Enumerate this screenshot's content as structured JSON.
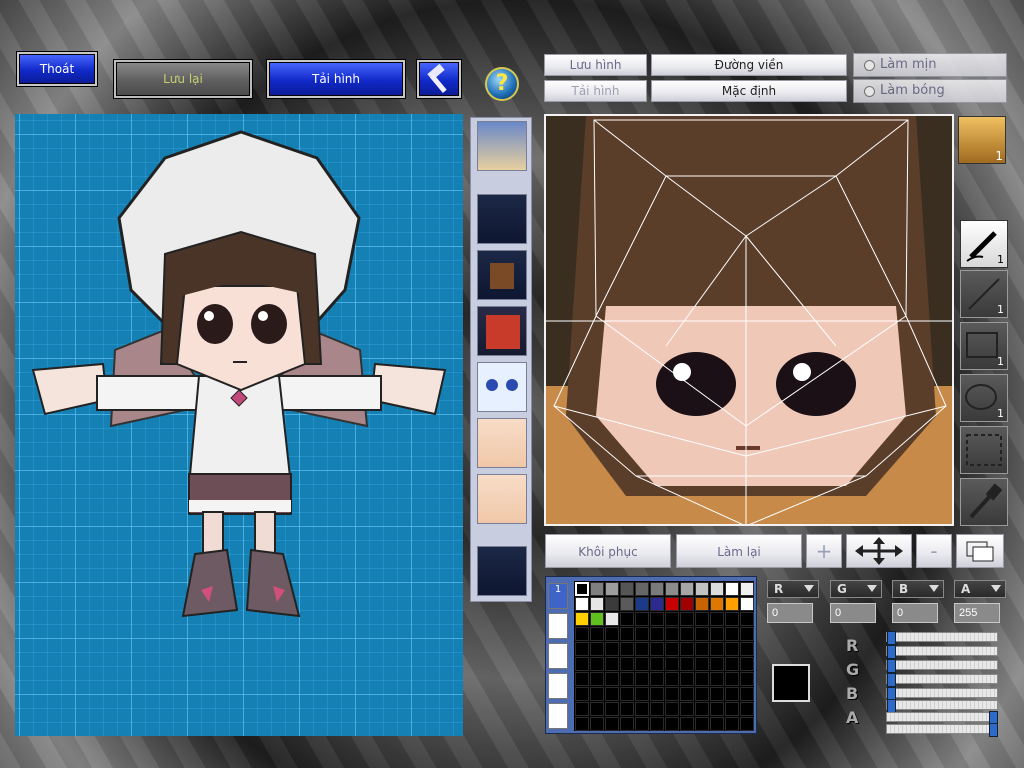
{
  "toolbar": {
    "exit": "Thoát",
    "save": "Lưu lại",
    "reload": "Tải hình",
    "tools_icon": "hammer-icon",
    "help": "?"
  },
  "texture_toolbar": {
    "save": "Lưu hình",
    "load": "Tải hình",
    "outline": "Đường viền",
    "default": "Mặc định",
    "smooth": "Làm mịn",
    "shade": "Làm bóng"
  },
  "head_thumb_count": "1",
  "tools": [
    {
      "name": "pen-tool",
      "count": "1"
    },
    {
      "name": "line-tool",
      "count": "1"
    },
    {
      "name": "rect-tool",
      "count": "1"
    },
    {
      "name": "ellipse-tool",
      "count": "1"
    },
    {
      "name": "select-tool",
      "count": ""
    },
    {
      "name": "eyedropper-tool",
      "count": ""
    }
  ],
  "edit_buttons": {
    "restore": "Khôi phục",
    "redo": "Làm lại",
    "zoom_in": "+",
    "zoom_out": "-"
  },
  "palette": {
    "tab_1": "1",
    "colors": [
      "#000000",
      "#7f7f7f",
      "#9d9d9d",
      "#555555",
      "#666666",
      "#7a7a7a",
      "#8c8c8c",
      "#a6a6a6",
      "#c2c2c2",
      "#dcdcdc",
      "#ffffff",
      "#f0f0f0",
      "#ffffff",
      "#e6e6e6",
      "#3b3b3b",
      "#5a5a5a",
      "#1c3a8a",
      "#2a2a90",
      "#c80000",
      "#a00000",
      "#c86400",
      "#e07800",
      "#ffa000",
      "#ffffff",
      "#ffd000",
      "#60c020",
      "#e8e8e8"
    ],
    "selected": "#000000"
  },
  "channels": {
    "r_label": "R",
    "g_label": "G",
    "b_label": "B",
    "a_label": "A",
    "r": "0",
    "g": "0",
    "b": "0",
    "a": "255",
    "r_level": 0,
    "g_level": 0,
    "b_level": 0,
    "a_level": 1
  }
}
